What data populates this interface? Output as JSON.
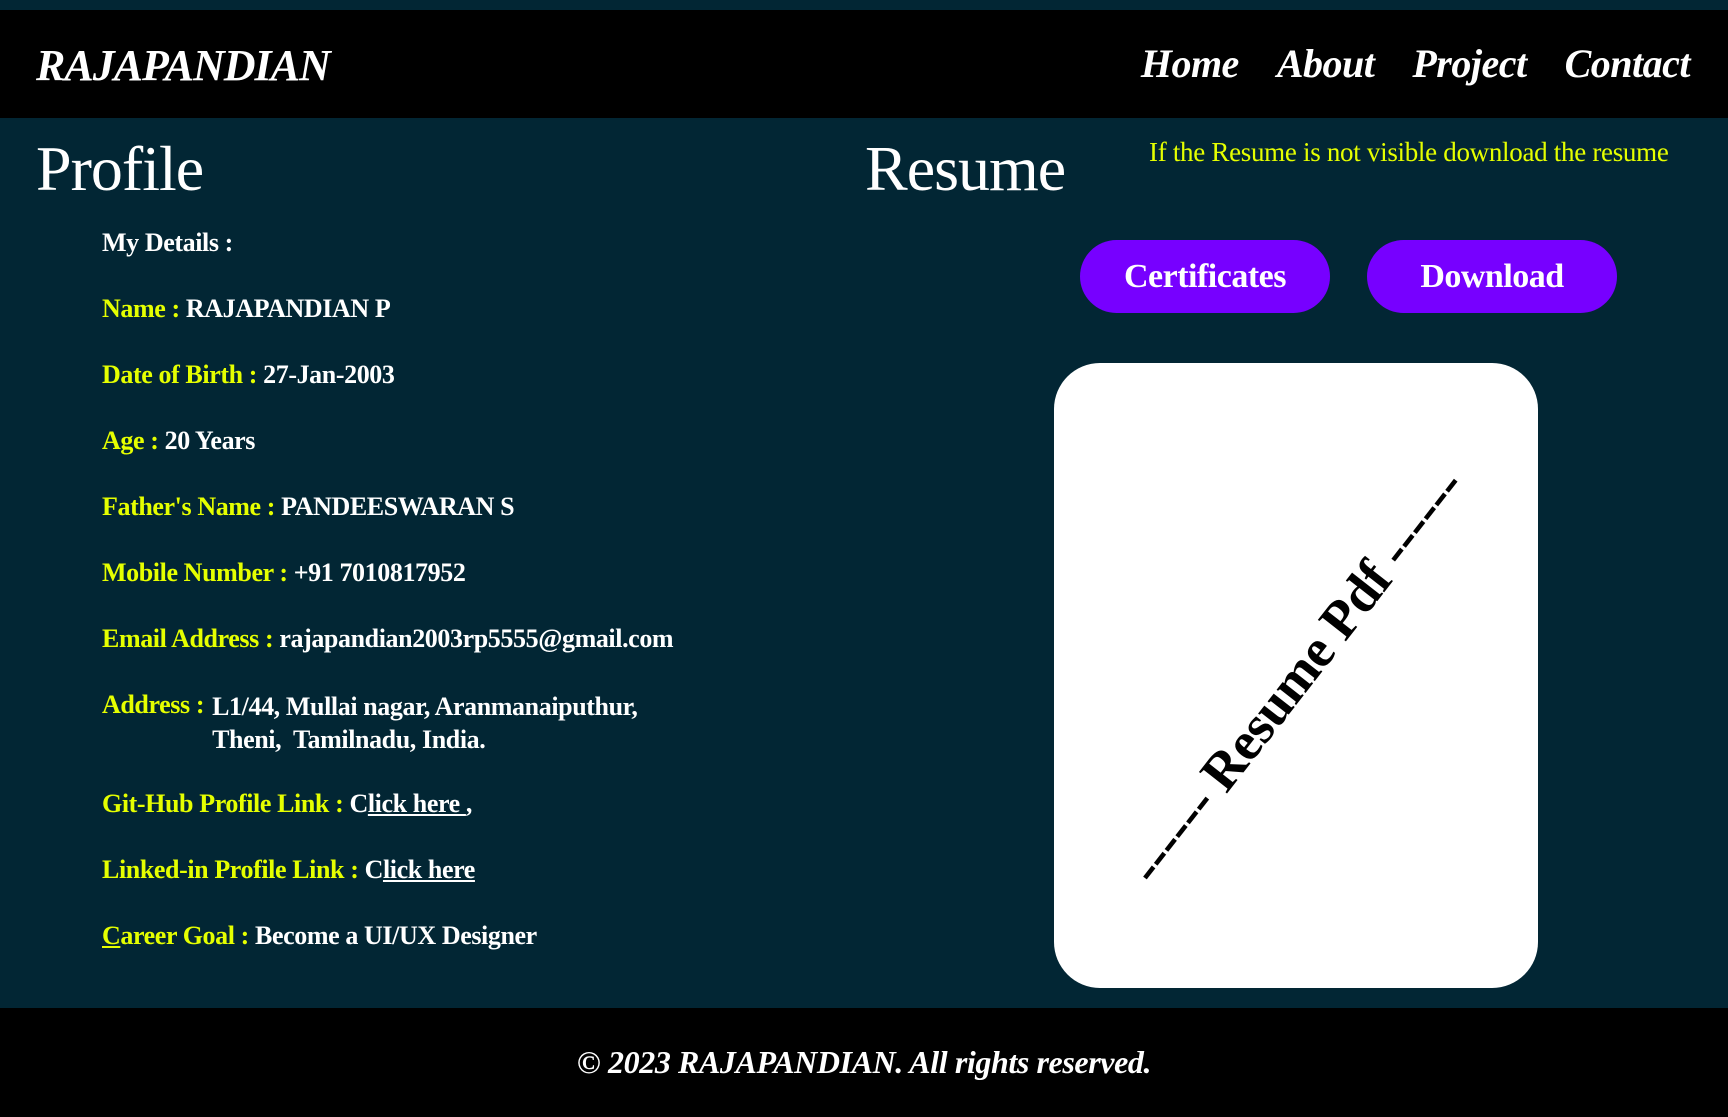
{
  "header": {
    "logo": "RAJAPANDIAN",
    "nav": [
      "Home",
      "About",
      "Project",
      "Contact"
    ]
  },
  "profile": {
    "title": "Profile",
    "my_details": "My Details :",
    "fields": [
      {
        "label": "Name :",
        "value": "RAJAPANDIAN P"
      },
      {
        "label": "Date of Birth :",
        "value": "27-Jan-2003"
      },
      {
        "label": "Age :",
        "value": "20 Years"
      },
      {
        "label": "Father's Name :",
        "value": "PANDEESWARAN S"
      },
      {
        "label": "Mobile Number :",
        "value": "+91 7010817952"
      },
      {
        "label": "Email Address :",
        "value": "rajapandian2003rp5555@gmail.com"
      }
    ],
    "address": {
      "label": "Address :",
      "line1": "L1/44, Mullai nagar, Aranmanaiputhur,",
      "line2": "Theni,  Tamilnadu, India."
    },
    "github": {
      "label": "Git-Hub Profile Link :",
      "prefix": "C",
      "link": "lick here ",
      "suffix": ","
    },
    "linkedin": {
      "label": "Linked-in Profile Link :",
      "prefix": "C",
      "link": "lick here"
    },
    "career": {
      "label_first": "C",
      "label_rest": "areer Goal :",
      "value": "Become a UI/UX Designer"
    }
  },
  "resume": {
    "title": "Resume",
    "note": "If the Resume is not visible download the resume",
    "certificates_label": "Certificates",
    "download_label": "Download",
    "pdf_placeholder": "------ Resume Pdf ------"
  },
  "footer": {
    "text": "© 2023 RAJAPANDIAN. All rights reserved."
  },
  "colors": {
    "background": "#022634",
    "accent_yellow": "#e5ff00",
    "button_purple": "#7700ff"
  }
}
